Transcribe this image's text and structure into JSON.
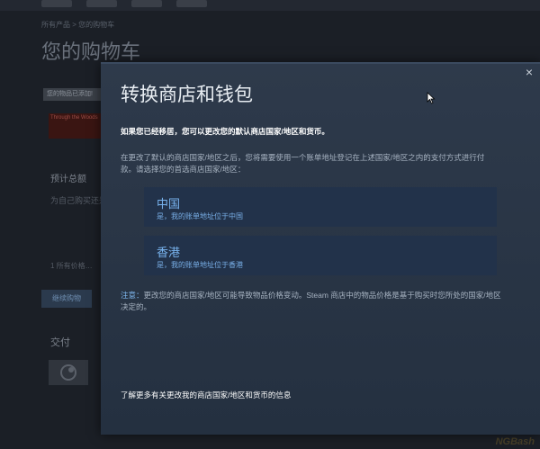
{
  "background": {
    "breadcrumb": "所有产品 > 您的购物车",
    "page_title": "您的购物车",
    "item_tag": "您的物品已添加!",
    "thumb_text": "Through the Woods",
    "estimated_total": "预计总额",
    "gift_text": "为自己购买还是…",
    "note_text": "1 所有价格…",
    "continue_button": "继续购物",
    "payment_heading": "交付",
    "watermark": "NGBash"
  },
  "modal": {
    "title": "转换商店和钱包",
    "close_icon": "×",
    "intro": "如果您已经移居，您可以更改您的默认商店国家/地区和货币。",
    "description": "在更改了默认的商店国家/地区之后，您将需要使用一个账单地址登记在上述国家/地区之内的支付方式进行付款。请选择您的首选商店国家/地区：",
    "options": [
      {
        "name": "中国",
        "sub": "是，我的账单地址位于中国"
      },
      {
        "name": "香港",
        "sub": "是，我的账单地址位于香港"
      }
    ],
    "notice_label": "注意：",
    "notice_text": "更改您的商店国家/地区可能导致物品价格变动。Steam 商店中的物品价格是基于购买时您所处的国家/地区决定的。",
    "learn_more": "了解更多有关更改我的商店国家/地区和货币的信息"
  },
  "colors": {
    "modal_bg": "#2e3a4b",
    "option_bg": "#22324a",
    "accent_blue": "#78b3ee"
  }
}
